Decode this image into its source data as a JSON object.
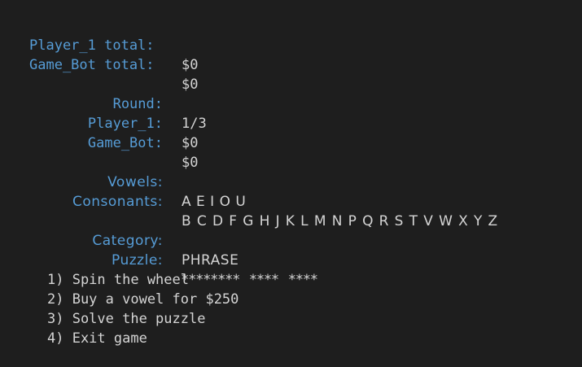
{
  "totals": {
    "player1_label": "Player_1 total:",
    "player1_value": "$0",
    "bot_label": "Game_Bot total:",
    "bot_value": "$0"
  },
  "round": {
    "round_label": "Round:",
    "round_value": "1/3",
    "player1_label": "Player_1:",
    "player1_value": "$0",
    "bot_label": "Game_Bot:",
    "bot_value": "$0"
  },
  "letters": {
    "vowels_label": "Vowels:",
    "vowels_value": "A E I O U",
    "consonants_label": "Consonants:",
    "consonants_value": "B C D F G H J K L M N P Q R S T V W X Y Z"
  },
  "puzzle": {
    "category_label": "Category:",
    "category_value": "PHRASE",
    "puzzle_label": "Puzzle:",
    "puzzle_value": "********  ****  ****"
  },
  "menu": [
    "1) Spin the wheel",
    "2) Buy a vowel for $250",
    "3) Solve the puzzle",
    "4) Exit game"
  ],
  "colors": {
    "background": "#1e1e1e",
    "label": "#569cd6",
    "text": "#d4d4d4"
  }
}
